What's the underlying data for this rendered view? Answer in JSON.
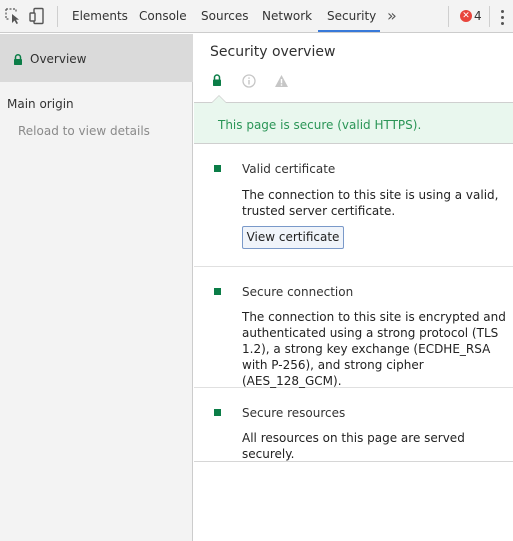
{
  "toolbar": {
    "tabs": [
      {
        "label": "Elements"
      },
      {
        "label": "Console"
      },
      {
        "label": "Sources"
      },
      {
        "label": "Network"
      },
      {
        "label": "Security"
      }
    ],
    "active_tab": "Security",
    "error_count": "4",
    "icons": [
      "inspect-element-icon",
      "device-toolbar-icon",
      "more-tabs-chevron-icon",
      "error-icon",
      "more-options-icon"
    ]
  },
  "sidebar": {
    "overview_label": "Overview",
    "main_origin_heading": "Main origin",
    "reload_hint": "Reload to view details"
  },
  "main": {
    "title": "Security overview",
    "summary": "This page is secure (valid HTTPS).",
    "sections": [
      {
        "title": "Valid certificate",
        "body": "The connection to this site is using a valid, trusted server certificate.",
        "button_label": "View certificate"
      },
      {
        "title": "Secure connection",
        "body": "The connection to this site is encrypted and authenticated using a strong protocol (TLS 1.2), a strong key exchange (ECDHE_RSA with P-256), and strong cipher (AES_128_GCM)."
      },
      {
        "title": "Secure resources",
        "body": "All resources on this page are served securely."
      }
    ]
  },
  "colors": {
    "secure_green": "#0b7d47",
    "summary_text": "#2a9556",
    "summary_bg": "#e9f7ee",
    "active_tab_underline": "#3879d9",
    "error_red": "#e8453c"
  }
}
